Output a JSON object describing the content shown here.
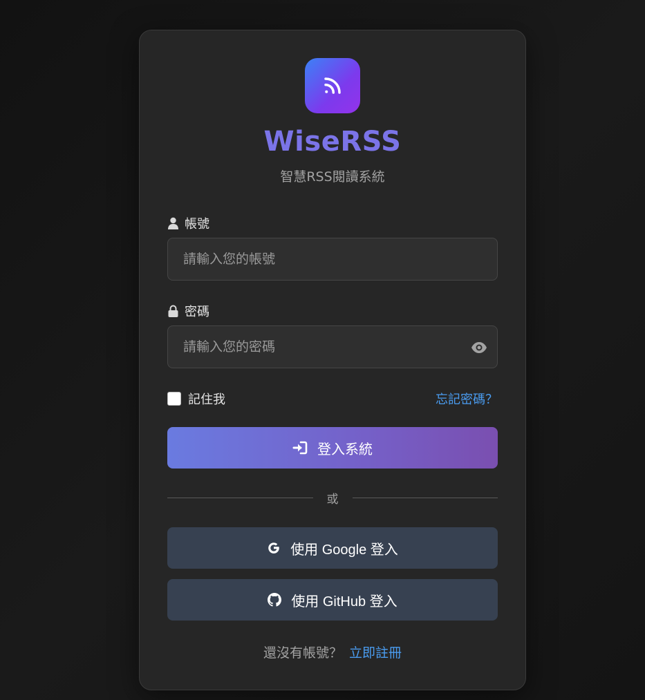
{
  "app": {
    "title": "WiseRSS",
    "subtitle": "智慧RSS閱讀系統",
    "logo_icon": "rss-icon",
    "accent": "#7b74e8"
  },
  "form": {
    "account_label": "帳號",
    "account_placeholder": "請輸入您的帳號",
    "account_value": "",
    "password_label": "密碼",
    "password_placeholder": "請輸入您的密碼",
    "password_value": "",
    "remember_label": "記住我",
    "remember_checked": false,
    "forgot_label": "忘記密碼？",
    "login_label": "登入系統",
    "divider_label": "或"
  },
  "social": {
    "google_label": "使用 Google 登入",
    "github_label": "使用 GitHub 登入",
    "button_color": "#374151"
  },
  "footer": {
    "signup_prompt": "還沒有帳號？",
    "signup_link": "立即註冊",
    "link_color": "#4a9cf0"
  }
}
